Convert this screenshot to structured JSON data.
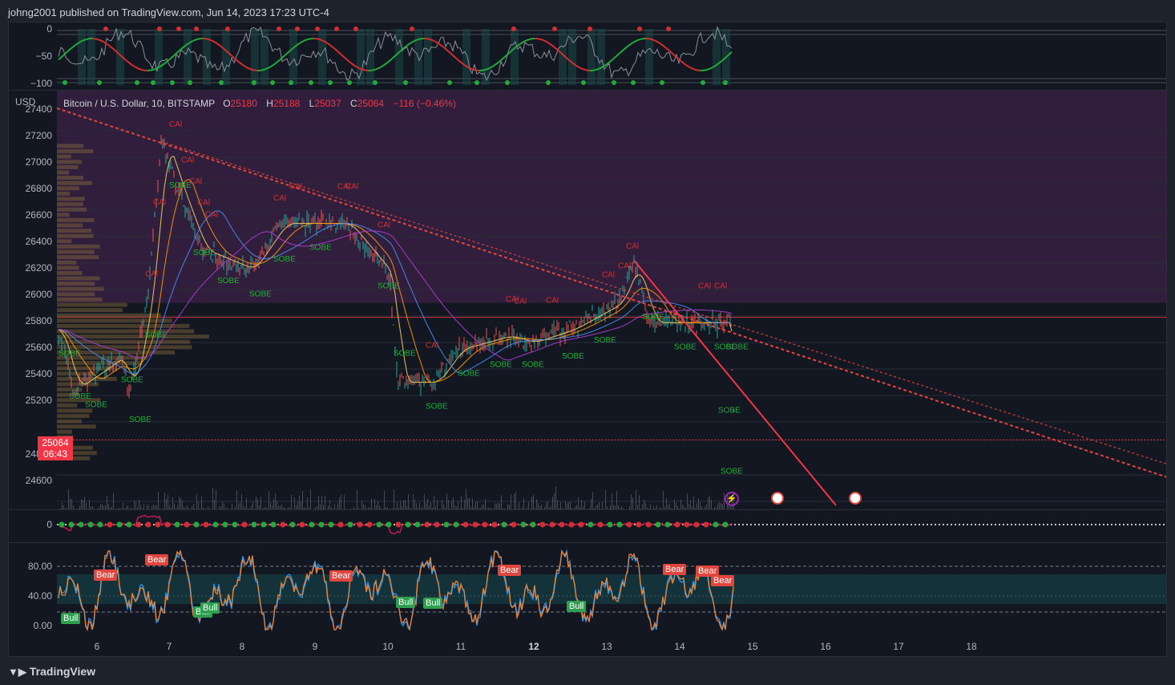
{
  "publish": {
    "text": "johng2001 published on TradingView.com, Jun 14, 2023 17:23 UTC-4"
  },
  "symbol": {
    "name": "Bitcoin / U.S. Dollar, 10, BITSTAMP",
    "o_label": "O",
    "o": "25180",
    "h_label": "H",
    "h": "25188",
    "l_label": "L",
    "l": "25037",
    "c_label": "C",
    "c": "25064",
    "change": "−116 (−0.46%)"
  },
  "currency": "USD",
  "last_price": {
    "price": "25064",
    "countdown": "06:43"
  },
  "price_axis": [
    "27400",
    "27200",
    "27000",
    "26800",
    "26600",
    "26400",
    "26200",
    "26000",
    "25800",
    "25600",
    "25400",
    "25200",
    "24800",
    "24600"
  ],
  "top_axis": [
    "0",
    "−50",
    "−100"
  ],
  "mid_axis": [
    "0"
  ],
  "bottom_axis": [
    "80.00",
    "40.00",
    "0.00"
  ],
  "time_axis": [
    {
      "label": "6",
      "bold": false
    },
    {
      "label": "7",
      "bold": false
    },
    {
      "label": "8",
      "bold": false
    },
    {
      "label": "9",
      "bold": false
    },
    {
      "label": "10",
      "bold": false
    },
    {
      "label": "11",
      "bold": false
    },
    {
      "label": "12",
      "bold": true
    },
    {
      "label": "13",
      "bold": false
    },
    {
      "label": "14",
      "bold": false
    },
    {
      "label": "15",
      "bold": false
    },
    {
      "label": "16",
      "bold": false
    },
    {
      "label": "17",
      "bold": false
    },
    {
      "label": "18",
      "bold": false
    }
  ],
  "signals": {
    "cal": "CAl",
    "sobe": "SOBE"
  },
  "osc_badges": {
    "bear": "Bear",
    "bull": "Bull"
  },
  "colors": {
    "bg": "#131722",
    "up": "#26a69a",
    "down": "#ef5350",
    "sell": "#f23645",
    "buy": "#22ab38",
    "purple": "#9c27b0",
    "orange": "#e8843a",
    "blue": "#2962ff"
  },
  "footer": {
    "brand": "TradingView"
  }
}
